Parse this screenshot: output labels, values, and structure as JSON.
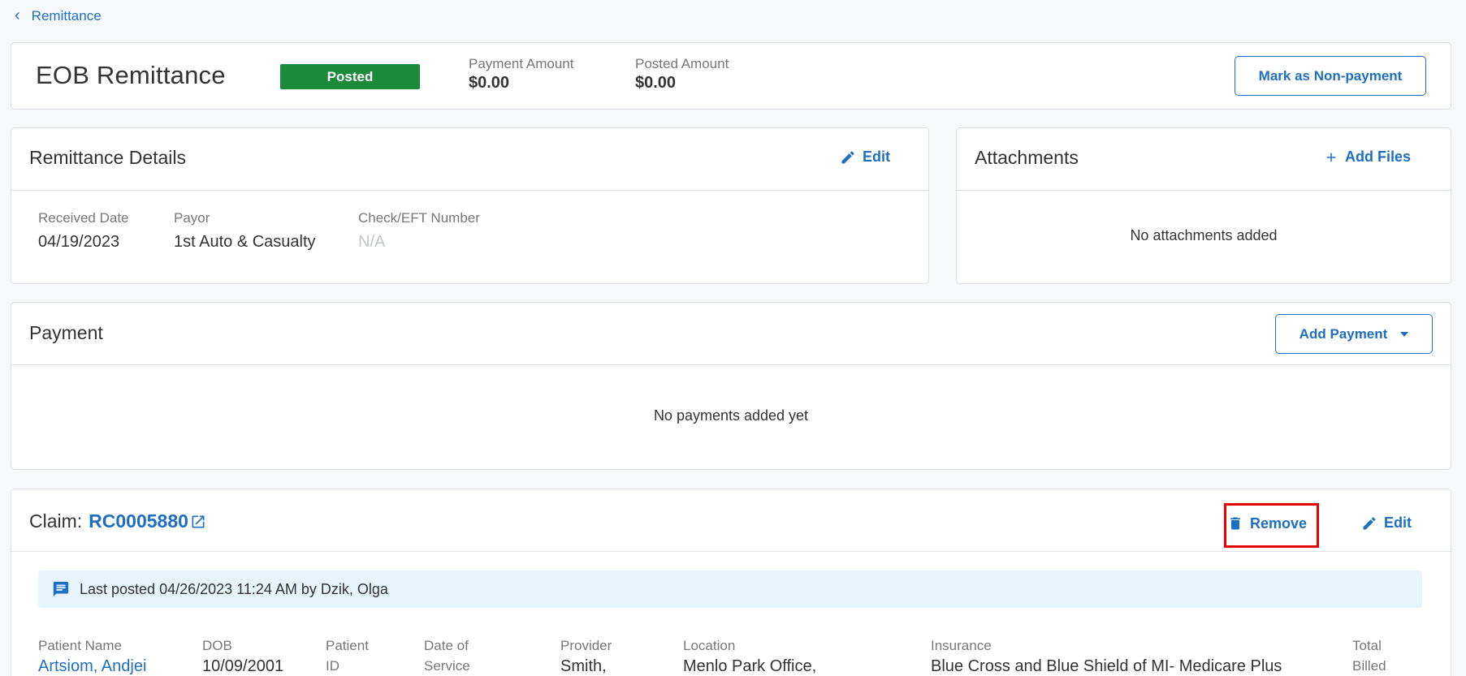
{
  "nav": {
    "back_label": "Remittance"
  },
  "header": {
    "title": "EOB Remittance",
    "status_badge": "Posted",
    "payment_amount_label": "Payment Amount",
    "payment_amount_value": "$0.00",
    "posted_amount_label": "Posted Amount",
    "posted_amount_value": "$0.00",
    "mark_button_label": "Mark as Non-payment"
  },
  "details": {
    "title": "Remittance Details",
    "edit_label": "Edit",
    "received_date_label": "Received Date",
    "received_date_value": "04/19/2023",
    "payor_label": "Payor",
    "payor_value": "1st Auto & Casualty",
    "check_label": "Check/EFT Number",
    "check_value": "N/A"
  },
  "attachments": {
    "title": "Attachments",
    "add_label": "Add Files",
    "empty_text": "No attachments added"
  },
  "payment": {
    "title": "Payment",
    "add_label": "Add Payment",
    "empty_text": "No payments added yet"
  },
  "claim": {
    "prefix": "Claim:",
    "id": "RC0005880",
    "remove_label": "Remove",
    "edit_label": "Edit",
    "banner_text": "Last posted 04/26/2023 11:24 AM by Dzik, Olga",
    "columns": [
      {
        "label": "Patient Name",
        "value": "Artsiom, Andjei"
      },
      {
        "label": "DOB",
        "value": "10/09/2001"
      },
      {
        "label": "Patient ID",
        "value": ""
      },
      {
        "label": "Date of Service",
        "value": ""
      },
      {
        "label": "Provider",
        "value": "Smith,"
      },
      {
        "label": "Location",
        "value": "Menlo Park Office,"
      },
      {
        "label": "Insurance",
        "value": "Blue Cross and Blue Shield of MI- Medicare Plus"
      },
      {
        "label": "Total Billed",
        "value": ""
      }
    ]
  },
  "colors": {
    "accent": "#1e6fc2",
    "posted": "#1b8a3a",
    "highlight": "#e60000",
    "banner_bg": "#e6f4fc"
  }
}
